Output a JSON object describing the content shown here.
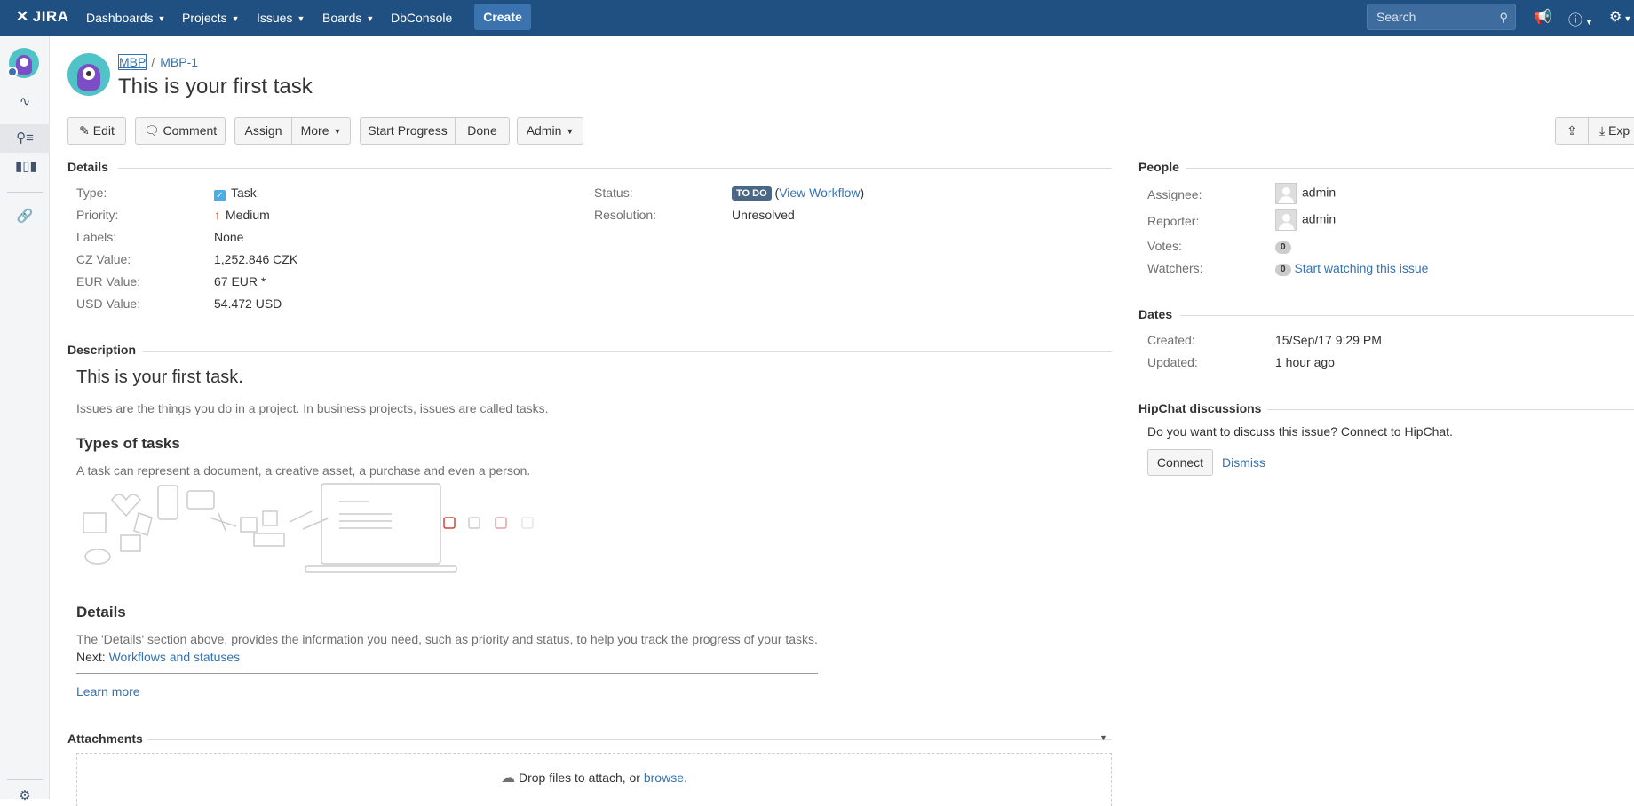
{
  "topbar": {
    "logo": "JIRA",
    "nav": [
      "Dashboards",
      "Projects",
      "Issues",
      "Boards",
      "DbConsole"
    ],
    "create_label": "Create",
    "search_placeholder": "Search"
  },
  "issue": {
    "project_key": "MBP",
    "issue_key": "MBP-1",
    "summary": "This is your first task"
  },
  "toolbar": {
    "edit": "Edit",
    "comment": "Comment",
    "assign": "Assign",
    "more": "More",
    "start_progress": "Start Progress",
    "done": "Done",
    "admin": "Admin",
    "export": "Exp"
  },
  "details": {
    "title": "Details",
    "type_label": "Type:",
    "type_value": "Task",
    "priority_label": "Priority:",
    "priority_value": "Medium",
    "labels_label": "Labels:",
    "labels_value": "None",
    "cz_label": "CZ Value:",
    "cz_value": "1,252.846 CZK",
    "eur_label": "EUR Value:",
    "eur_value": "67 EUR *",
    "usd_label": "USD Value:",
    "usd_value": "54.472 USD",
    "status_label": "Status:",
    "status_value": "TO DO",
    "workflow_open": "(",
    "view_workflow": "View Workflow",
    "workflow_close": ")",
    "resolution_label": "Resolution:",
    "resolution_value": "Unresolved"
  },
  "description": {
    "title": "Description",
    "h1": "This is your first task.",
    "p1": "Issues are the things you do in a project. In business projects, issues are called tasks.",
    "h2": "Types of tasks",
    "p2": "A task can represent a document, a creative asset, a purchase and even a person.",
    "h3": "Details",
    "p3": "The 'Details' section above, provides the information you need, such as priority and status, to help you track the progress of your tasks.",
    "next_label": "Next:",
    "next_link": "Workflows and statuses",
    "learn_more": "Learn more"
  },
  "attachments": {
    "title": "Attachments",
    "drop_text": "Drop files to attach, or",
    "browse": "browse."
  },
  "people": {
    "title": "People",
    "assignee_label": "Assignee:",
    "assignee": "admin",
    "reporter_label": "Reporter:",
    "reporter": "admin",
    "votes_label": "Votes:",
    "votes": "0",
    "watchers_label": "Watchers:",
    "watchers": "0",
    "watch_link": "Start watching this issue"
  },
  "dates": {
    "title": "Dates",
    "created_label": "Created:",
    "created": "15/Sep/17 9:29 PM",
    "updated_label": "Updated:",
    "updated": "1 hour ago"
  },
  "hipchat": {
    "title": "HipChat discussions",
    "text": "Do you want to discuss this issue? Connect to HipChat.",
    "connect": "Connect",
    "dismiss": "Dismiss"
  }
}
